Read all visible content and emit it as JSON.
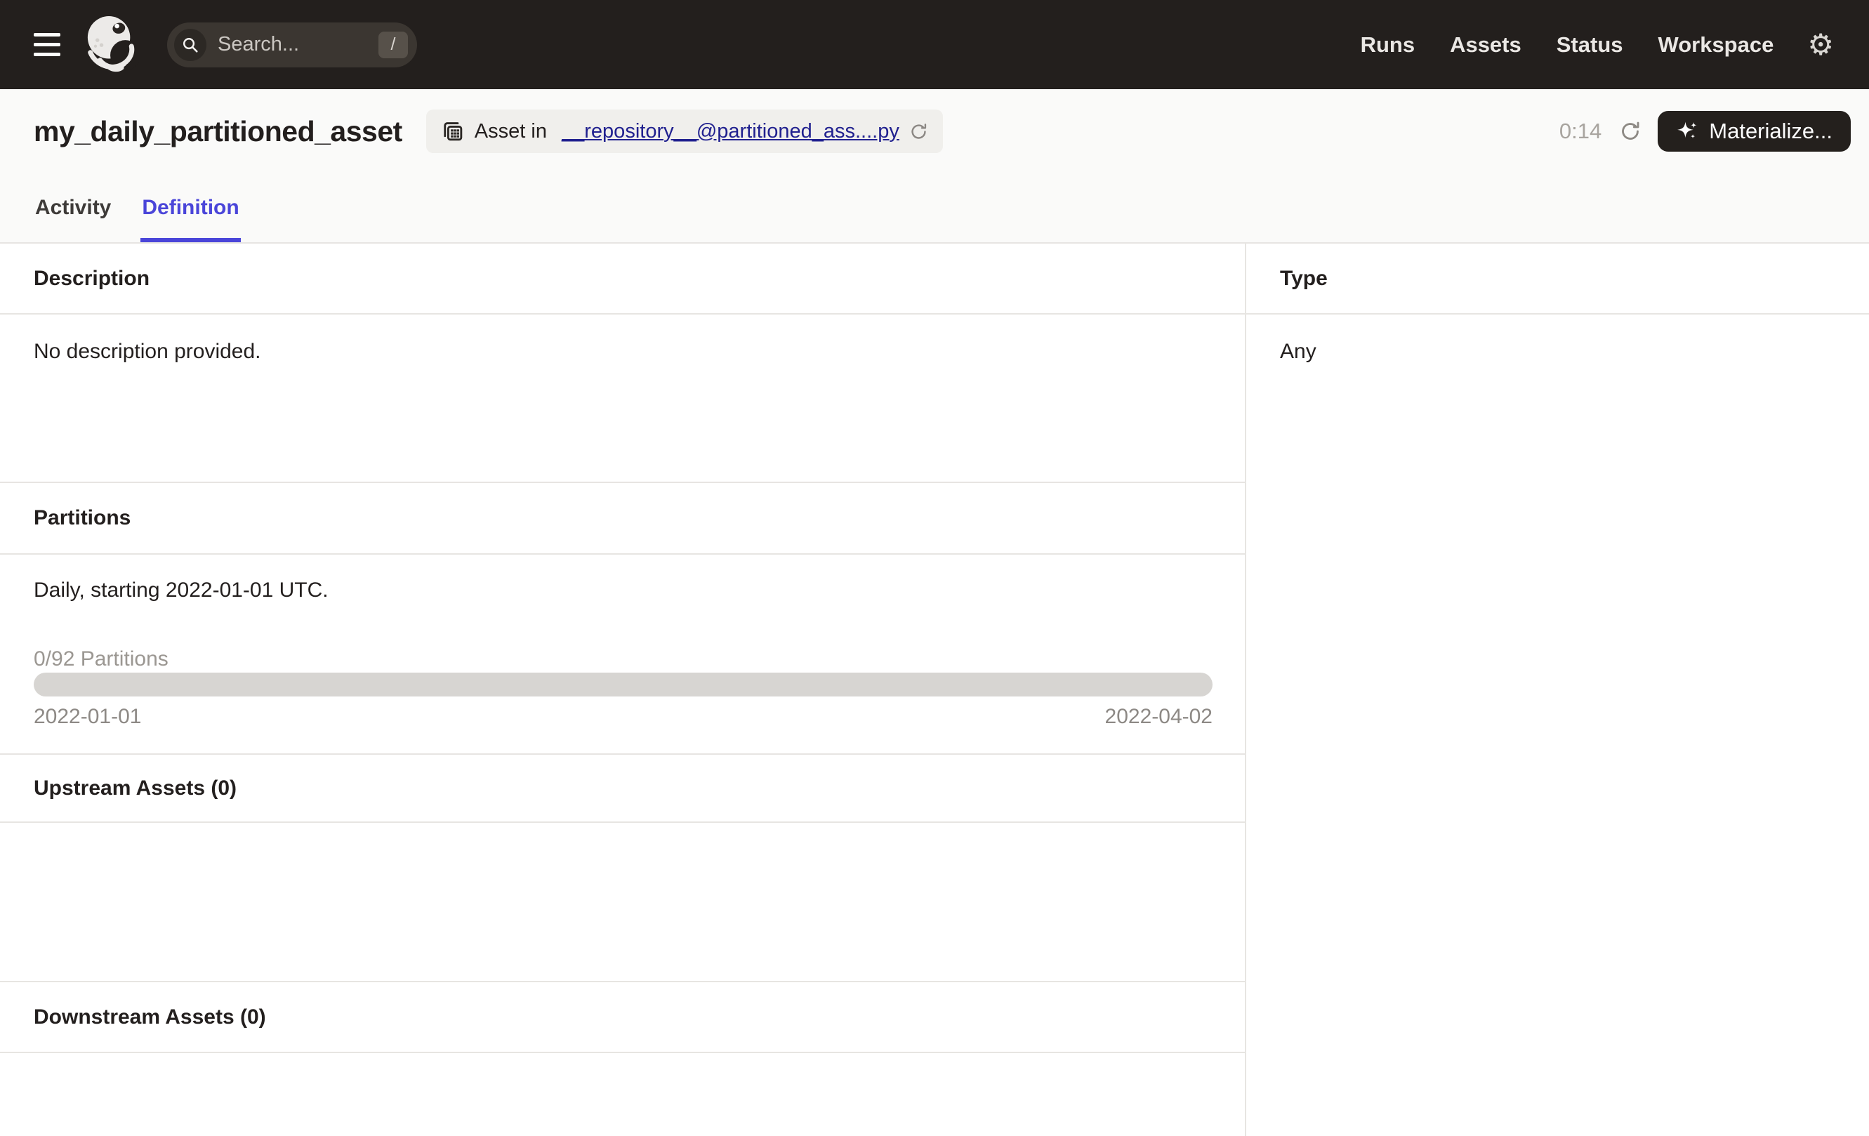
{
  "topbar": {
    "search": {
      "placeholder": "Search...",
      "shortcut": "/"
    },
    "nav": [
      {
        "label": "Runs"
      },
      {
        "label": "Assets"
      },
      {
        "label": "Status"
      },
      {
        "label": "Workspace"
      }
    ],
    "gear_glyph": "⚙"
  },
  "header": {
    "title": "my_daily_partitioned_asset",
    "asset_badge": {
      "prefix": "Asset in ",
      "link": "__repository__@partitioned_ass....py"
    },
    "refresh_timer": "0:14",
    "materialize": {
      "label": "Materialize..."
    },
    "tabs": [
      {
        "label": "Activity",
        "active": false
      },
      {
        "label": "Definition",
        "active": true
      }
    ]
  },
  "main": {
    "description": {
      "title": "Description",
      "body": "No description provided."
    },
    "partitions": {
      "title": "Partitions",
      "summary": "Daily, starting 2022-01-01 UTC.",
      "count_label": "0/92 Partitions",
      "progress_percent": 0,
      "range_start": "2022-01-01",
      "range_end": "2022-04-02"
    },
    "upstream": {
      "title": "Upstream Assets (0)"
    },
    "downstream": {
      "title": "Downstream Assets (0)"
    },
    "type": {
      "title": "Type",
      "body": "Any"
    }
  },
  "colors": {
    "topbar_bg": "#231f1d",
    "accent": "#4a45d9",
    "link": "#21218f",
    "header_bg": "#fafaf9",
    "border": "#e7e5e2",
    "progress_track": "#d7d5d2"
  }
}
